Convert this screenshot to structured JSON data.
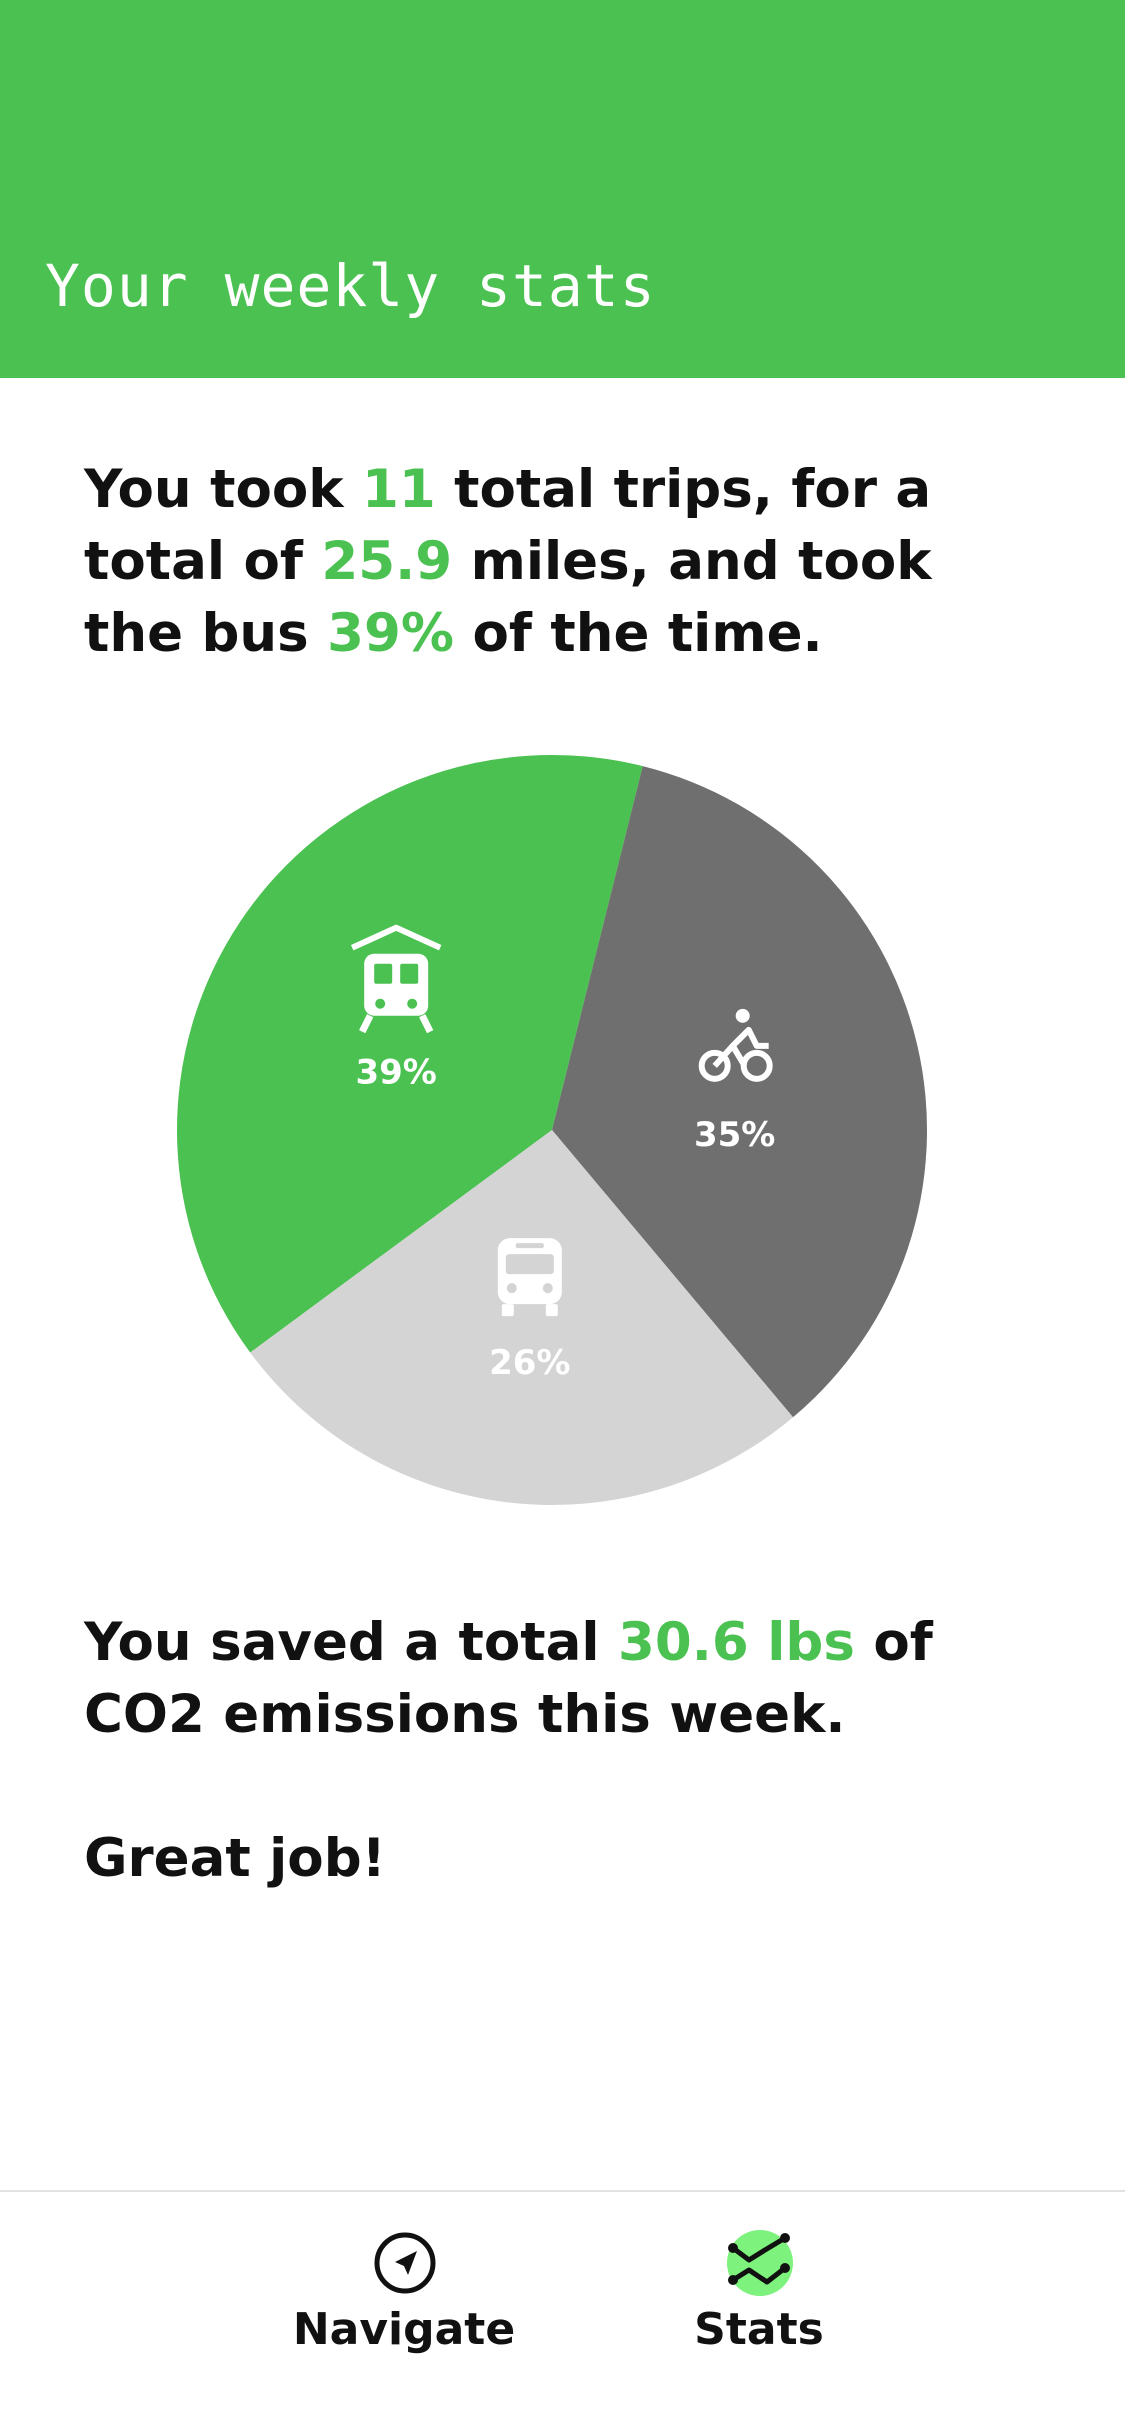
{
  "header": {
    "title": "Your weekly stats"
  },
  "summary": {
    "p1": "You took ",
    "trips": "11",
    "p2": " total trips, for a total of ",
    "miles": "25.9",
    "p3": " miles, and took the bus ",
    "bus_pct": "39%",
    "p4": " of the time."
  },
  "chart_data": {
    "type": "pie",
    "slices": [
      {
        "label": "39%",
        "value": 39,
        "icon": "train-icon",
        "color": "#4ac150"
      },
      {
        "label": "35%",
        "value": 35,
        "icon": "bike-icon",
        "color": "#6f6f6f"
      },
      {
        "label": "26%",
        "value": 26,
        "icon": "bus-icon",
        "color": "#d4d4d4"
      }
    ]
  },
  "emissions": {
    "p1": "You saved a total ",
    "amount": "30.6 lbs",
    "p2": " of CO2 emissions this week."
  },
  "congrats": "Great job!",
  "tabs": [
    {
      "label": "Navigate",
      "icon": "navigation-arrow-icon",
      "active": false
    },
    {
      "label": "Stats",
      "icon": "trend-chart-icon",
      "active": true
    }
  ],
  "colors": {
    "accent": "#4ac150",
    "active_tab_bg": "#7df27d",
    "dark_slice": "#6f6f6f",
    "light_slice": "#d4d4d4"
  }
}
